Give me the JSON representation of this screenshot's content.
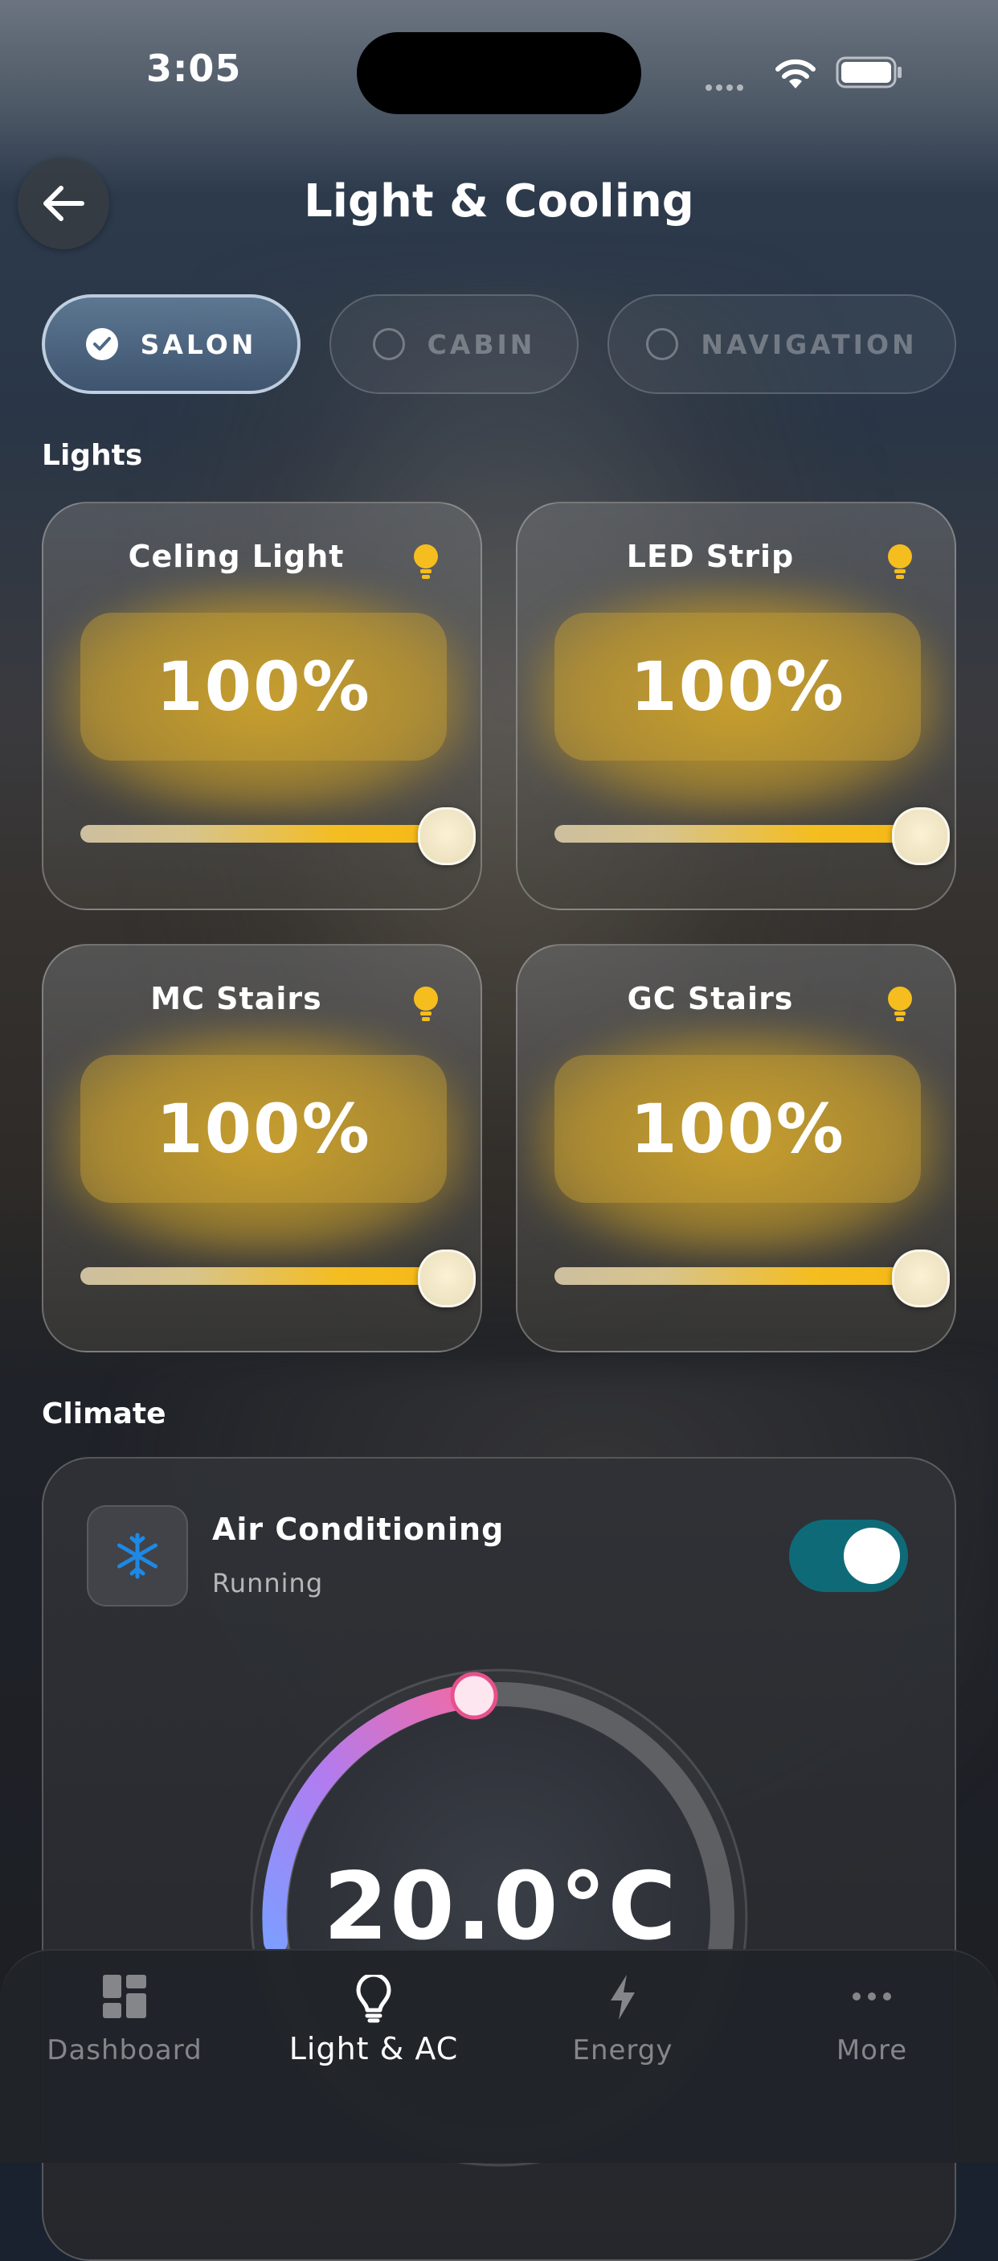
{
  "status_bar": {
    "time": "3:05"
  },
  "header": {
    "title": "Light & Cooling"
  },
  "zones": [
    {
      "label": "SALON",
      "selected": true
    },
    {
      "label": "CABIN",
      "selected": false
    },
    {
      "label": "NAVIGATION",
      "selected": false
    }
  ],
  "lights_section": {
    "title": "Lights",
    "cards": [
      {
        "name": "Celing Light",
        "value": "100%",
        "level": 1.0
      },
      {
        "name": "LED Strip",
        "value": "100%",
        "level": 1.0
      },
      {
        "name": "MC Stairs",
        "value": "100%",
        "level": 1.0
      },
      {
        "name": "GC Stairs",
        "value": "100%",
        "level": 1.0
      }
    ]
  },
  "climate_section": {
    "title": "Climate",
    "ac": {
      "title": "Air Conditioning",
      "status": "Running",
      "enabled": true,
      "temperature": "20.0°C"
    }
  },
  "tabbar": {
    "items": [
      {
        "label": "Dashboard",
        "icon": "dashboard-icon",
        "active": false
      },
      {
        "label": "Light & AC",
        "icon": "lightbulb-icon",
        "active": true
      },
      {
        "label": "Energy",
        "icon": "bolt-icon",
        "active": false
      },
      {
        "label": "More",
        "icon": "more-icon",
        "active": false
      }
    ]
  },
  "colors": {
    "accent_gold": "#f4bd20",
    "toggle_on": "#0f6a78",
    "snow_blue": "#1e88e5"
  }
}
